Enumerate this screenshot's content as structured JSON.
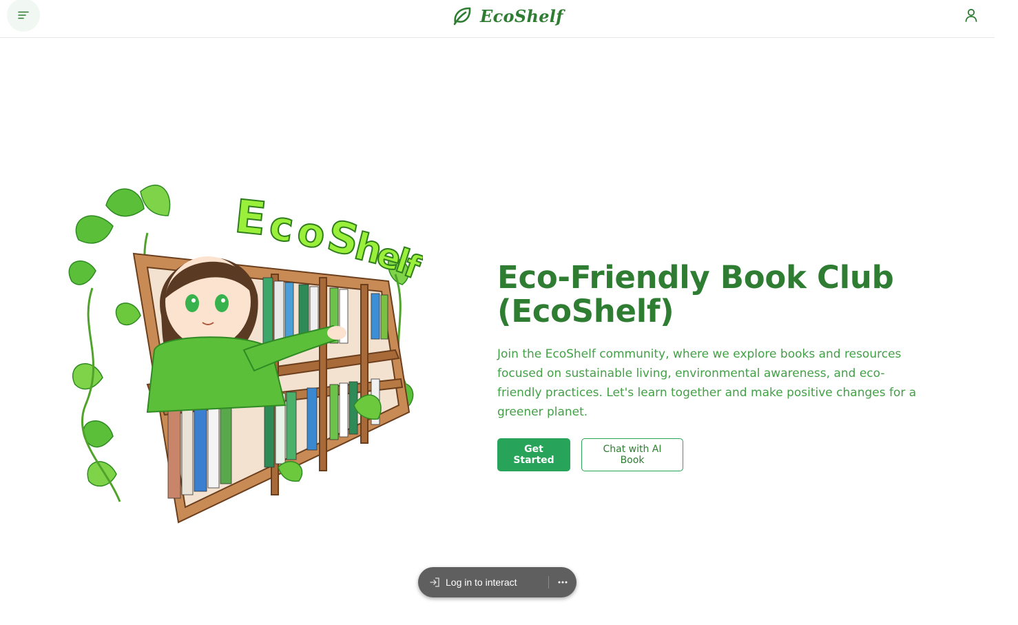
{
  "header": {
    "brand_name": "EcoShelf",
    "menu_icon": "menu-icon",
    "logo_icon": "leaf-icon",
    "user_icon": "user-icon"
  },
  "hero": {
    "illustration_sign": "EcoShelf",
    "title": "Eco-Friendly Book Club (EcoShelf)",
    "description": "Join the EcoShelf community, where we explore books and resources focused on sustainable living, environmental awareness, and eco-friendly practices. Let's learn together and make positive changes for a greener planet.",
    "primary_button": "Get Started",
    "secondary_button": "Chat with AI Book"
  },
  "login_bar": {
    "label": "Log in to interact",
    "login_icon": "login-arrow-icon",
    "more_icon": "more-horizontal-icon"
  },
  "colors": {
    "brand_green": "#2e7d32",
    "accent_green": "#27a35a",
    "text_green": "#43a047",
    "pill_bg": "#5f5f5f"
  }
}
